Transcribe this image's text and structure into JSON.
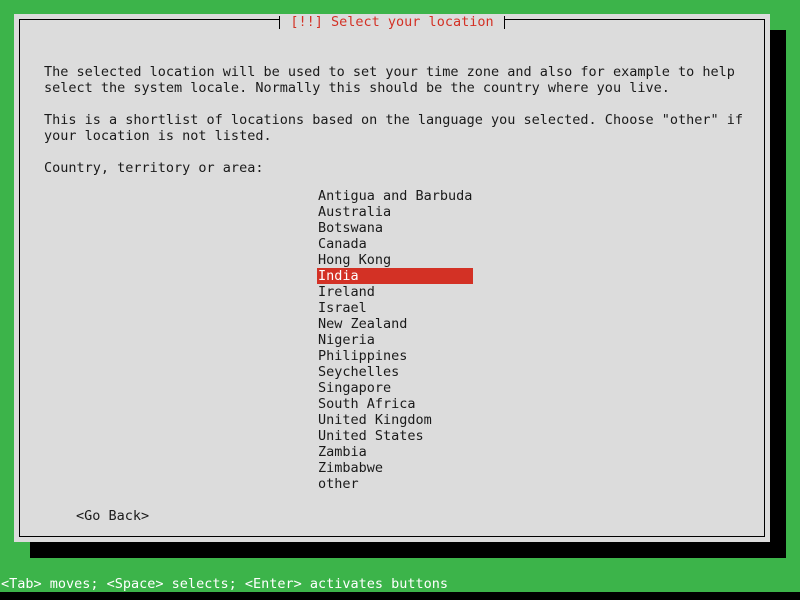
{
  "screen": {
    "background_color": "#3cb44a",
    "dialog_background_color": "#dcdcdc",
    "accent_color": "#d33125",
    "text_color": "#1a1a1a",
    "shadow_color": "#000000"
  },
  "dialog": {
    "title": "[!!] Select your location",
    "paragraphs": [
      "The selected location will be used to set your time zone and also for example to help\nselect the system locale. Normally this should be the country where you live.",
      "This is a shortlist of locations based on the language you selected. Choose \"other\" if\nyour location is not listed."
    ],
    "prompt_label": "Country, territory or area:",
    "list": {
      "selected_index": 5,
      "items": [
        "Antigua and Barbuda",
        "Australia",
        "Botswana",
        "Canada",
        "Hong Kong",
        "India",
        "Ireland",
        "Israel",
        "New Zealand",
        "Nigeria",
        "Philippines",
        "Seychelles",
        "Singapore",
        "South Africa",
        "United Kingdom",
        "United States",
        "Zambia",
        "Zimbabwe",
        "other"
      ]
    },
    "buttons": {
      "go_back": "<Go Back>"
    }
  },
  "status_bar": {
    "help_text": "<Tab> moves; <Space> selects; <Enter> activates buttons"
  }
}
